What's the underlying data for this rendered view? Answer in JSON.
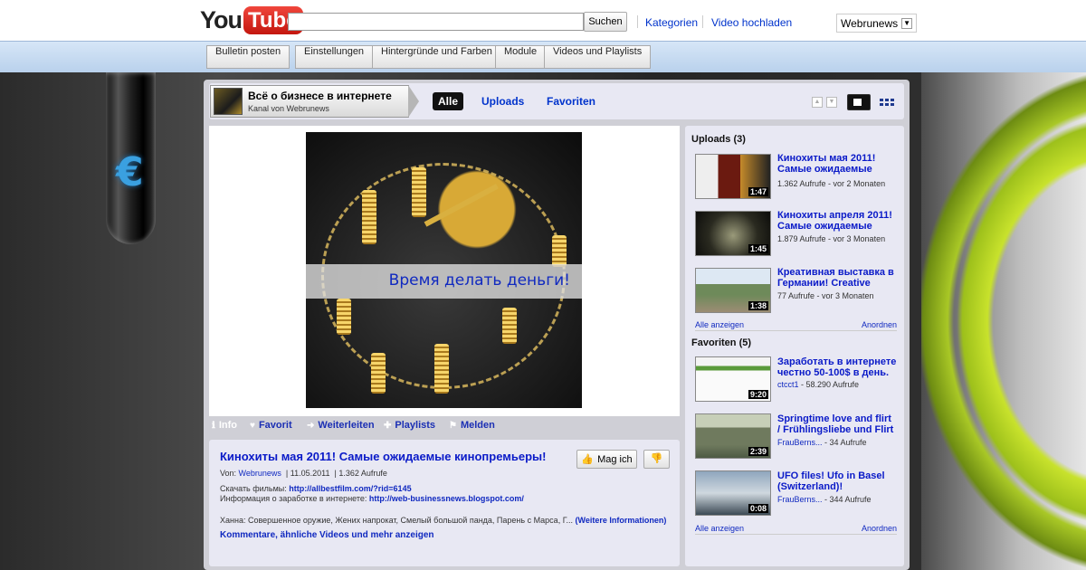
{
  "masthead": {
    "logo_you": "You",
    "logo_tube": "Tube",
    "search_button": "Suchen",
    "links": [
      "Kategorien",
      "Video hochladen"
    ],
    "user": "Webrunews"
  },
  "editbar": {
    "buttons": [
      "Bulletin posten",
      "Einstellungen",
      "Hintergründe und Farben",
      "Module",
      "Videos und Playlists"
    ]
  },
  "channel": {
    "name": "Всё о бизнесе в интернете",
    "subtitle": "Kanal von Webrunews",
    "tabs": [
      "Alle",
      "Uploads",
      "Favoriten"
    ]
  },
  "player": {
    "banner_text": "Время делать деньги!"
  },
  "actions": [
    "Info",
    "Favorit",
    "Weiterleiten",
    "Playlists",
    "Melden"
  ],
  "video": {
    "title": "Кинохиты мая 2011! Самые ожидаемые кинопремьеры!",
    "meta_from_label": "Von:",
    "meta_user": "Webrunews",
    "meta_date": "11.05.2011",
    "meta_views": "1.362 Aufrufe",
    "like_label": "Mag ich",
    "desc_line1_label": "Скачать фильмы:",
    "desc_line1_link": "http://allbestfilm.com/?rid=6145",
    "desc_line2_label": "Информация о заработке в интернете:",
    "desc_line2_link": "http://web-businessnews.blogspot.com/",
    "desc_line3": "Ханна: Совершенное оружие, Жених напрокат, Смелый большой панда, Парень с Марса, Г...",
    "desc_more": "(Weitere Informationen)",
    "more_link": "Kommentare, ähnliche Videos und mehr anzeigen"
  },
  "uploads": {
    "header": "Uploads (3)",
    "items": [
      {
        "title": "Кинохиты мая 2011! Самые ожидаемые",
        "meta": "1.362 Aufrufe - vor 2 Monaten",
        "duration": "1:47"
      },
      {
        "title": "Кинохиты апреля 2011! Самые ожидаемые",
        "meta": "1.879 Aufrufe - vor 3 Monaten",
        "duration": "1:45"
      },
      {
        "title": "Креативная выставка в Германии! Creative",
        "meta": "77 Aufrufe - vor 3 Monaten",
        "duration": "1:38"
      }
    ],
    "show_all": "Alle anzeigen",
    "arrange": "Anordnen"
  },
  "favorites": {
    "header": "Favoriten (5)",
    "items": [
      {
        "title": "Заработать в интернете честно 50-100$ в день.",
        "user": "ctcct1",
        "meta": " - 58.290 Aufrufe",
        "duration": "9:20"
      },
      {
        "title": "Springtime love and flirt / Frühlingsliebe und Flirt",
        "user": "FrauBerns...",
        "meta": " - 34 Aufrufe",
        "duration": "2:39"
      },
      {
        "title": "UFO files! Ufo in Basel (Switzerland)!",
        "user": "FrauBerns...",
        "meta": " - 344 Aufrufe",
        "duration": "0:08"
      }
    ],
    "show_all": "Alle anzeigen",
    "arrange": "Anordnen"
  },
  "icons": {
    "euro": "€"
  }
}
